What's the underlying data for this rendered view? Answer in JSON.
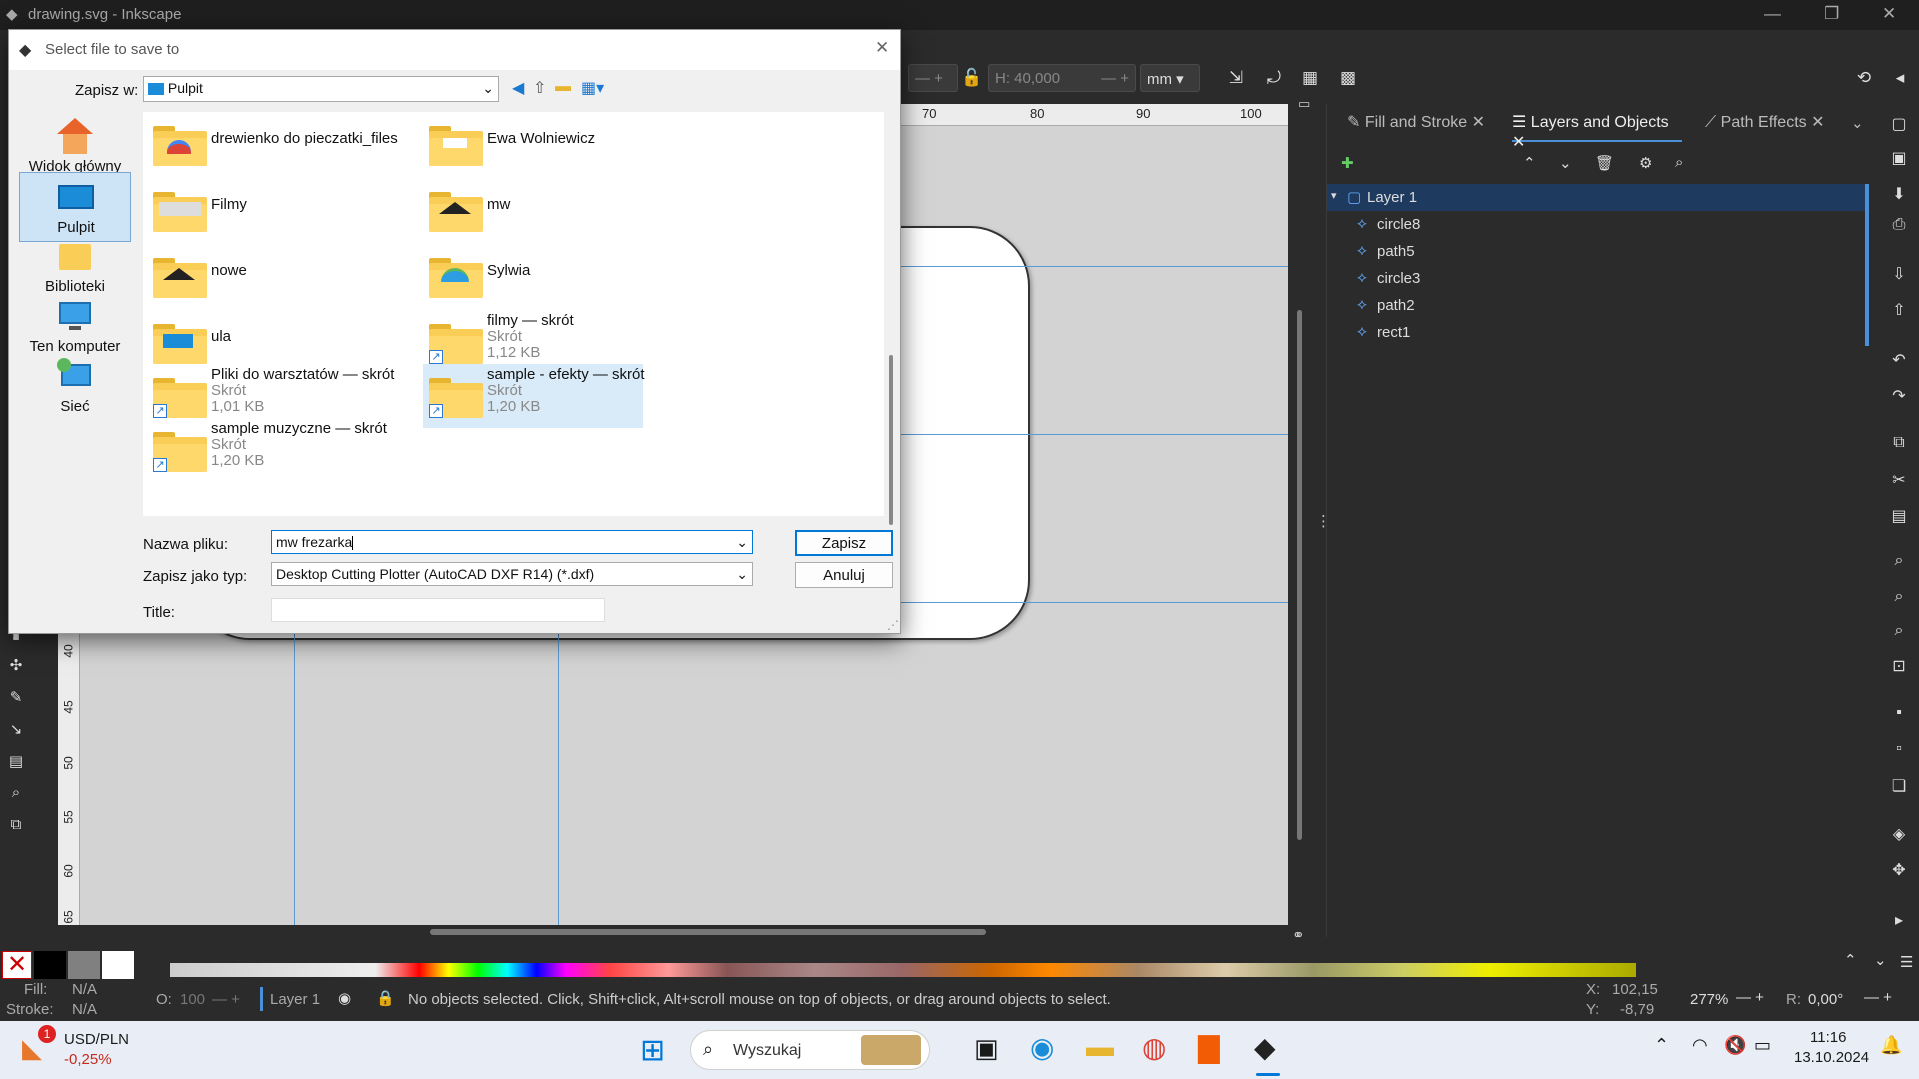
{
  "window": {
    "title": "drawing.svg - Inkscape"
  },
  "toolbar": {
    "h_label": "H:",
    "h_value": "40,000",
    "unit": "mm"
  },
  "ruler": {
    "ticks": [
      "70",
      "80",
      "90",
      "100"
    ]
  },
  "vruler": {
    "ticks": [
      "40",
      "45",
      "50",
      "55",
      "60",
      "65"
    ]
  },
  "panel": {
    "tabs": [
      {
        "label": "Fill and Stroke"
      },
      {
        "label": "Layers and Objects"
      },
      {
        "label": "Path Effects"
      }
    ],
    "layers": [
      {
        "label": "Layer 1"
      },
      {
        "label": "circle8"
      },
      {
        "label": "path5"
      },
      {
        "label": "circle3"
      },
      {
        "label": "path2"
      },
      {
        "label": "rect1"
      }
    ]
  },
  "dialog": {
    "title": "Select file to save to",
    "save_in_label": "Zapisz w:",
    "save_in_value": "Pulpit",
    "places": [
      {
        "label": "Widok główny"
      },
      {
        "label": "Pulpit"
      },
      {
        "label": "Biblioteki"
      },
      {
        "label": "Ten komputer"
      },
      {
        "label": "Sieć"
      }
    ],
    "files": [
      {
        "name": "drewienko do pieczatki_files"
      },
      {
        "name": "Ewa Wolniewicz"
      },
      {
        "name": "Filmy"
      },
      {
        "name": "mw"
      },
      {
        "name": "nowe"
      },
      {
        "name": "Sylwia"
      },
      {
        "name": "ula"
      },
      {
        "name": "filmy — skrót",
        "type": "Skrót",
        "size": "1,12 KB"
      },
      {
        "name": "Pliki do warsztatów — skrót",
        "type": "Skrót",
        "size": "1,01 KB"
      },
      {
        "name": "sample - efekty — skrót",
        "type": "Skrót",
        "size": "1,20 KB"
      },
      {
        "name": "sample muzyczne — skrót",
        "type": "Skrót",
        "size": "1,20 KB"
      }
    ],
    "filename_label": "Nazwa pliku:",
    "filename_value": "mw frezarka",
    "filetype_label": "Zapisz jako typ:",
    "filetype_value": "Desktop Cutting Plotter (AutoCAD DXF R14) (*.dxf)",
    "title_label": "Title:",
    "save_button": "Zapisz",
    "cancel_button": "Anuluj"
  },
  "status": {
    "fill_label": "Fill:",
    "fill_value": "N/A",
    "stroke_label": "Stroke:",
    "stroke_value": "N/A",
    "opacity_label": "O:",
    "opacity_value": "100",
    "layer": "Layer 1",
    "message": "No objects selected. Click, Shift+click, Alt+scroll mouse on top of objects, or drag around objects to select.",
    "x_label": "X:",
    "x_value": "102,15",
    "y_label": "Y:",
    "y_value": "-8,79",
    "zoom": "277%",
    "rot_label": "R:",
    "rotation": "0,00°"
  },
  "taskbar": {
    "badge": "1",
    "ticker": "USD/PLN",
    "ticker_change": "-0,25%",
    "search_placeholder": "Wyszukaj",
    "time": "11:16",
    "date": "13.10.2024"
  },
  "colors": {
    "accent": "#0078d7",
    "selection": "#cde4f7",
    "folder": "#f9cd56"
  }
}
